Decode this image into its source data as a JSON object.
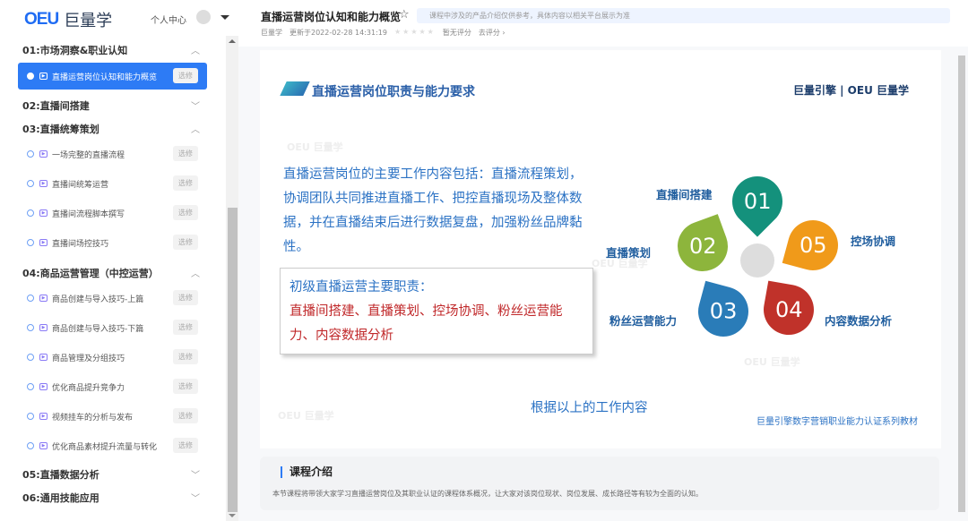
{
  "sidebar": {
    "logo": "巨量学",
    "logo_mark": "OEU",
    "user_center": "个人中心",
    "sections": [
      {
        "title": "01:市场洞察&职业认知",
        "items": [
          {
            "label": "直播运营岗位认知和能力概览",
            "btn": "选修"
          }
        ]
      },
      {
        "title": "02:直播间搭建",
        "items": []
      },
      {
        "title": "03:直播统筹策划",
        "items": [
          {
            "label": "一场完整的直播流程",
            "btn": "选修"
          },
          {
            "label": "直播间统筹运营",
            "btn": "选修"
          },
          {
            "label": "直播间流程脚本撰写",
            "btn": "选修"
          },
          {
            "label": "直播间场控技巧",
            "btn": "选修"
          }
        ]
      },
      {
        "title": "04:商品运营管理（中控运营）",
        "items": [
          {
            "label": "商品创建与导入技巧-上篇",
            "btn": "选修"
          },
          {
            "label": "商品创建与导入技巧-下篇",
            "btn": "选修"
          },
          {
            "label": "商品管理及分组技巧",
            "btn": "选修"
          },
          {
            "label": "优化商品提升竞争力",
            "btn": "选修"
          },
          {
            "label": "视频挂车的分析与发布",
            "btn": "选修"
          },
          {
            "label": "优化商品素材提升流量与转化",
            "btn": "选修"
          }
        ]
      },
      {
        "title": "05:直播数据分析",
        "items": []
      },
      {
        "title": "06:通用技能应用",
        "items": []
      }
    ]
  },
  "header": {
    "title": "直播运营岗位认知和能力概览",
    "notice": "课程中涉及的产品介绍仅供参考，具体内容以相关平台展示为准",
    "author": "巨量学",
    "updated": "更新于2022-02-28 14:31:19",
    "rating": "暂无评分",
    "rate_link": "去评分 ›"
  },
  "slide": {
    "heading": "直播运营岗位职责与能力要求",
    "brand": "巨量引擎 | OEU 巨量学",
    "text": "直播运营岗位的主要工作内容包括：直播流程策划，协调团队共同推进直播工作、把控直播现场及整体数据，并在直播结束后进行数据复盘，加强粉丝品牌黏性。",
    "box_title": "初级直播运营主要职责：",
    "box_text": "直播间搭建、直播策划、控场协调、粉丝运营能力、内容数据分析",
    "petals": [
      {
        "num": "01",
        "label": "直播间搭建",
        "color": "#14917c"
      },
      {
        "num": "02",
        "label": "直播策划",
        "color": "#8db53c"
      },
      {
        "num": "03",
        "label": "粉丝运营能力",
        "color": "#2a7cb8"
      },
      {
        "num": "04",
        "label": "内容数据分析",
        "color": "#c0322a"
      },
      {
        "num": "05",
        "label": "控场协调",
        "color": "#f09a1a"
      }
    ],
    "bottom": "根据以上的工作内容",
    "series": "巨量引擎数字营销职业能力认证系列教材",
    "watermark": "OEU 巨量学"
  },
  "intro": {
    "title": "课程介绍",
    "text": "本节课程将带领大家学习直播运营岗位及其职业认证的课程体系概况，让大家对该岗位现状、岗位发展、成长路径等有较为全面的认知。"
  }
}
